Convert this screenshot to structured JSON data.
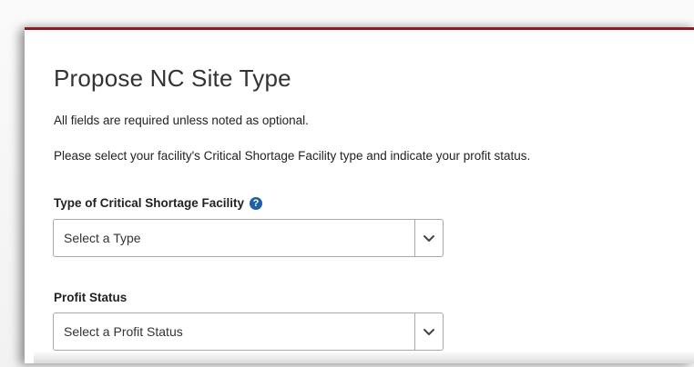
{
  "form": {
    "title": "Propose NC Site Type",
    "required_note": "All fields are required unless noted as optional.",
    "instructions": "Please select your facility's Critical Shortage Facility type and indicate your profit status.",
    "accent_color": "#8e1b24",
    "facility_type": {
      "label": "Type of Critical Shortage Facility",
      "help_icon": "question-circle-icon",
      "selected_value": "Select a Type"
    },
    "profit_status": {
      "label": "Profit Status",
      "selected_value": "Select a Profit Status"
    }
  }
}
